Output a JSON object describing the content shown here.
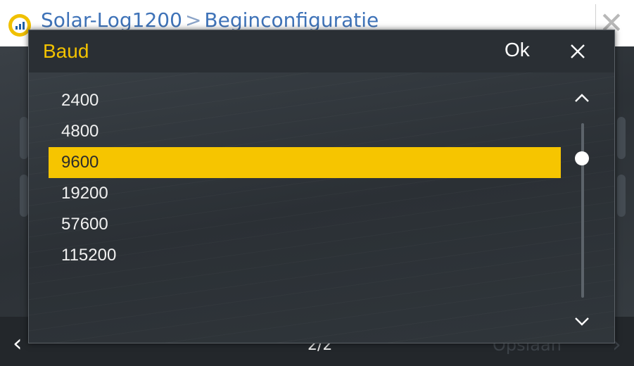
{
  "app": {
    "breadcrumb": {
      "root": "Solar-Log1200",
      "separator": ">",
      "current": "Beginconfiguratie"
    },
    "close_icon": "close-icon",
    "footer": {
      "prev_icon": "chevron-left-icon",
      "page": "2/2",
      "save_label": "Opslaan",
      "next_icon": "chevron-right-icon"
    }
  },
  "dialog": {
    "title": "Baud",
    "ok_label": "Ok",
    "close_icon": "close-icon",
    "options": [
      {
        "label": "2400"
      },
      {
        "label": "4800"
      },
      {
        "label": "9600"
      },
      {
        "label": "19200"
      },
      {
        "label": "57600"
      },
      {
        "label": "115200"
      }
    ],
    "selected": "9600",
    "scroll_up_icon": "chevron-up-icon",
    "scroll_down_icon": "chevron-down-icon"
  },
  "colors": {
    "accent": "#f6c500",
    "title": "#f2c200",
    "brand": "#3f73b8"
  }
}
